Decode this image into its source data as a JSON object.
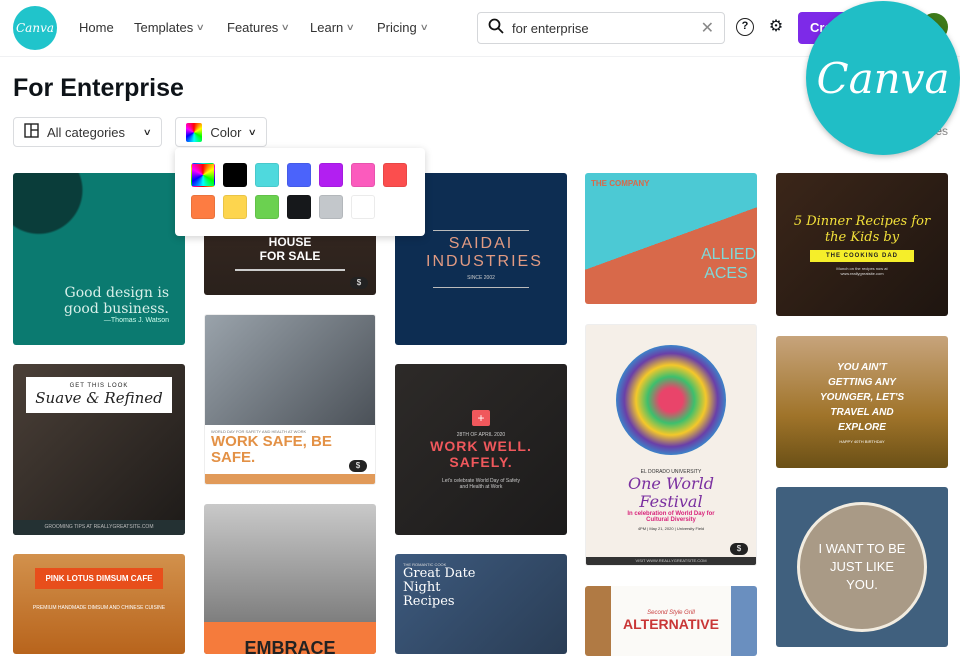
{
  "header": {
    "logo": "Canva",
    "nav": [
      {
        "label": "Home"
      },
      {
        "label": "Templates"
      },
      {
        "label": "Features"
      },
      {
        "label": "Learn"
      },
      {
        "label": "Pricing"
      }
    ],
    "search_value": "for enterprise",
    "help": "?",
    "gear": "⚙",
    "create_label": "Create a design"
  },
  "overlay_logo": "Canva",
  "page": {
    "title": "For Enterprise",
    "categories_label": "All categories",
    "color_label": "Color",
    "count_suffix": "templates"
  },
  "color_swatches": [
    "rainbow",
    "#000000",
    "#4fd9dd",
    "#4b63fb",
    "#b21ff1",
    "#fb5bbd",
    "#fb4e4e",
    "#fd7c42",
    "#fdd54e",
    "#6bd150",
    "#16181b",
    "#c3c7cb",
    "#ffffff"
  ],
  "cards": {
    "c1": {
      "quote": "Good design is good business.",
      "author": "—Thomas J. Watson"
    },
    "c2": {
      "title": "HOUSE FOR SALE"
    },
    "c3": {
      "title": "SAIDAI INDUSTRIES",
      "sub": "SINCE 2002"
    },
    "c4": {
      "top": "THE COMPANY",
      "title": "ALLIED ACES"
    },
    "c5": {
      "title": "5 Dinner Recipes for the Kids by",
      "tag": "THE COOKING DAD",
      "sub": "Munch on the recipes now at www.reallygreatsite.com"
    },
    "c6": {
      "top": "GET THIS LOOK",
      "title": "Suave & Refined",
      "foot": "GROOMING TIPS AT REALLYGREATSITE.COM"
    },
    "c7": {
      "top": "WORLD DAY FOR SAFETY AND HEALTH AT WORK",
      "title": "WORK SAFE, BE SAFE."
    },
    "c8": {
      "date": "28TH OF APRIL 2020",
      "title": "WORK WELL. SAFELY.",
      "sub": "Let's celebrate World Day of Safety and Health at Work"
    },
    "c9": {
      "top": "EL DORADO UNIVERSITY",
      "title": "One World Festival",
      "sub": "In celebration of World Day for Cultural Diversity",
      "meta": "4PM | May 21, 2020 | University Field",
      "foot": "VISIT WWW.REALLYGREATSITE.COM"
    },
    "c10": {
      "title": "YOU AIN'T GETTING ANY YOUNGER, LET'S TRAVEL AND EXPLORE",
      "sub": "HAPPY 40TH BIRTHDAY"
    },
    "c11": {
      "title": "PINK LOTUS DIMSUM CAFE",
      "sub": "PREMIUM HANDMADE DIMSUM AND CHINESE CUISINE"
    },
    "c12": {
      "title": "EMBRACE"
    },
    "c13": {
      "top": "THE ROMANTIC COOK",
      "title": "Great Date Night Recipes"
    },
    "c14": {
      "top": "Second Style Grill",
      "title": "ALTERNATIVE"
    },
    "c15": {
      "title": "I WANT TO BE JUST LIKE YOU."
    },
    "badge": "$"
  }
}
